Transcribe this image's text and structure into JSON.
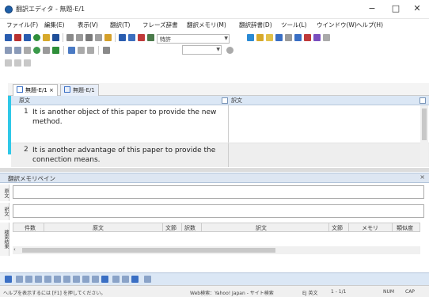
{
  "window": {
    "title": "翻訳エディタ - 無題-E/1",
    "minimize": "−",
    "maximize": "□",
    "close": "✕"
  },
  "menu": [
    "ファイル(F)",
    "編集(E)",
    "表示(V)",
    "翻訳(T)",
    "フレーズ辞書",
    "翻訳メモリ(M)",
    "翻訳辞書(D)",
    "ツール(L)",
    "ウインドウ(W)",
    "ヘルプ(H)"
  ],
  "toolbar": {
    "combo1_value": "特許"
  },
  "tabs": [
    {
      "label": "無題-E/1",
      "close": "×"
    },
    {
      "label": "無題-E/1"
    }
  ],
  "editor": {
    "header": {
      "source": "原文",
      "target": "訳文"
    },
    "rows": [
      {
        "num": "1",
        "source": "It is another object of this paper to provide the new method.",
        "target": ""
      },
      {
        "num": "2",
        "source": "It is another advantage of this paper to provide the connection means.",
        "target": ""
      }
    ]
  },
  "memo": {
    "title": "翻訳メモリペイン",
    "close": "×",
    "labels": {
      "source": "原文",
      "target": "訳文",
      "results": "検索結果"
    },
    "columns": [
      "件数",
      "原文",
      "文節",
      "訳数",
      "訳文",
      "文節",
      "メモリ",
      "類似度"
    ]
  },
  "statusbar": {
    "help": "ヘルプを表示するには [F1] を押してください。",
    "search": "Web検索：Yahoo! Japan - サイト検索",
    "mode": "EJ 英文",
    "pos": "1 - 1/1",
    "num": "NUM",
    "caps": "CAP"
  },
  "colors": {
    "accent": "#2fc8e8",
    "header_bg": "#dbe7f5"
  }
}
